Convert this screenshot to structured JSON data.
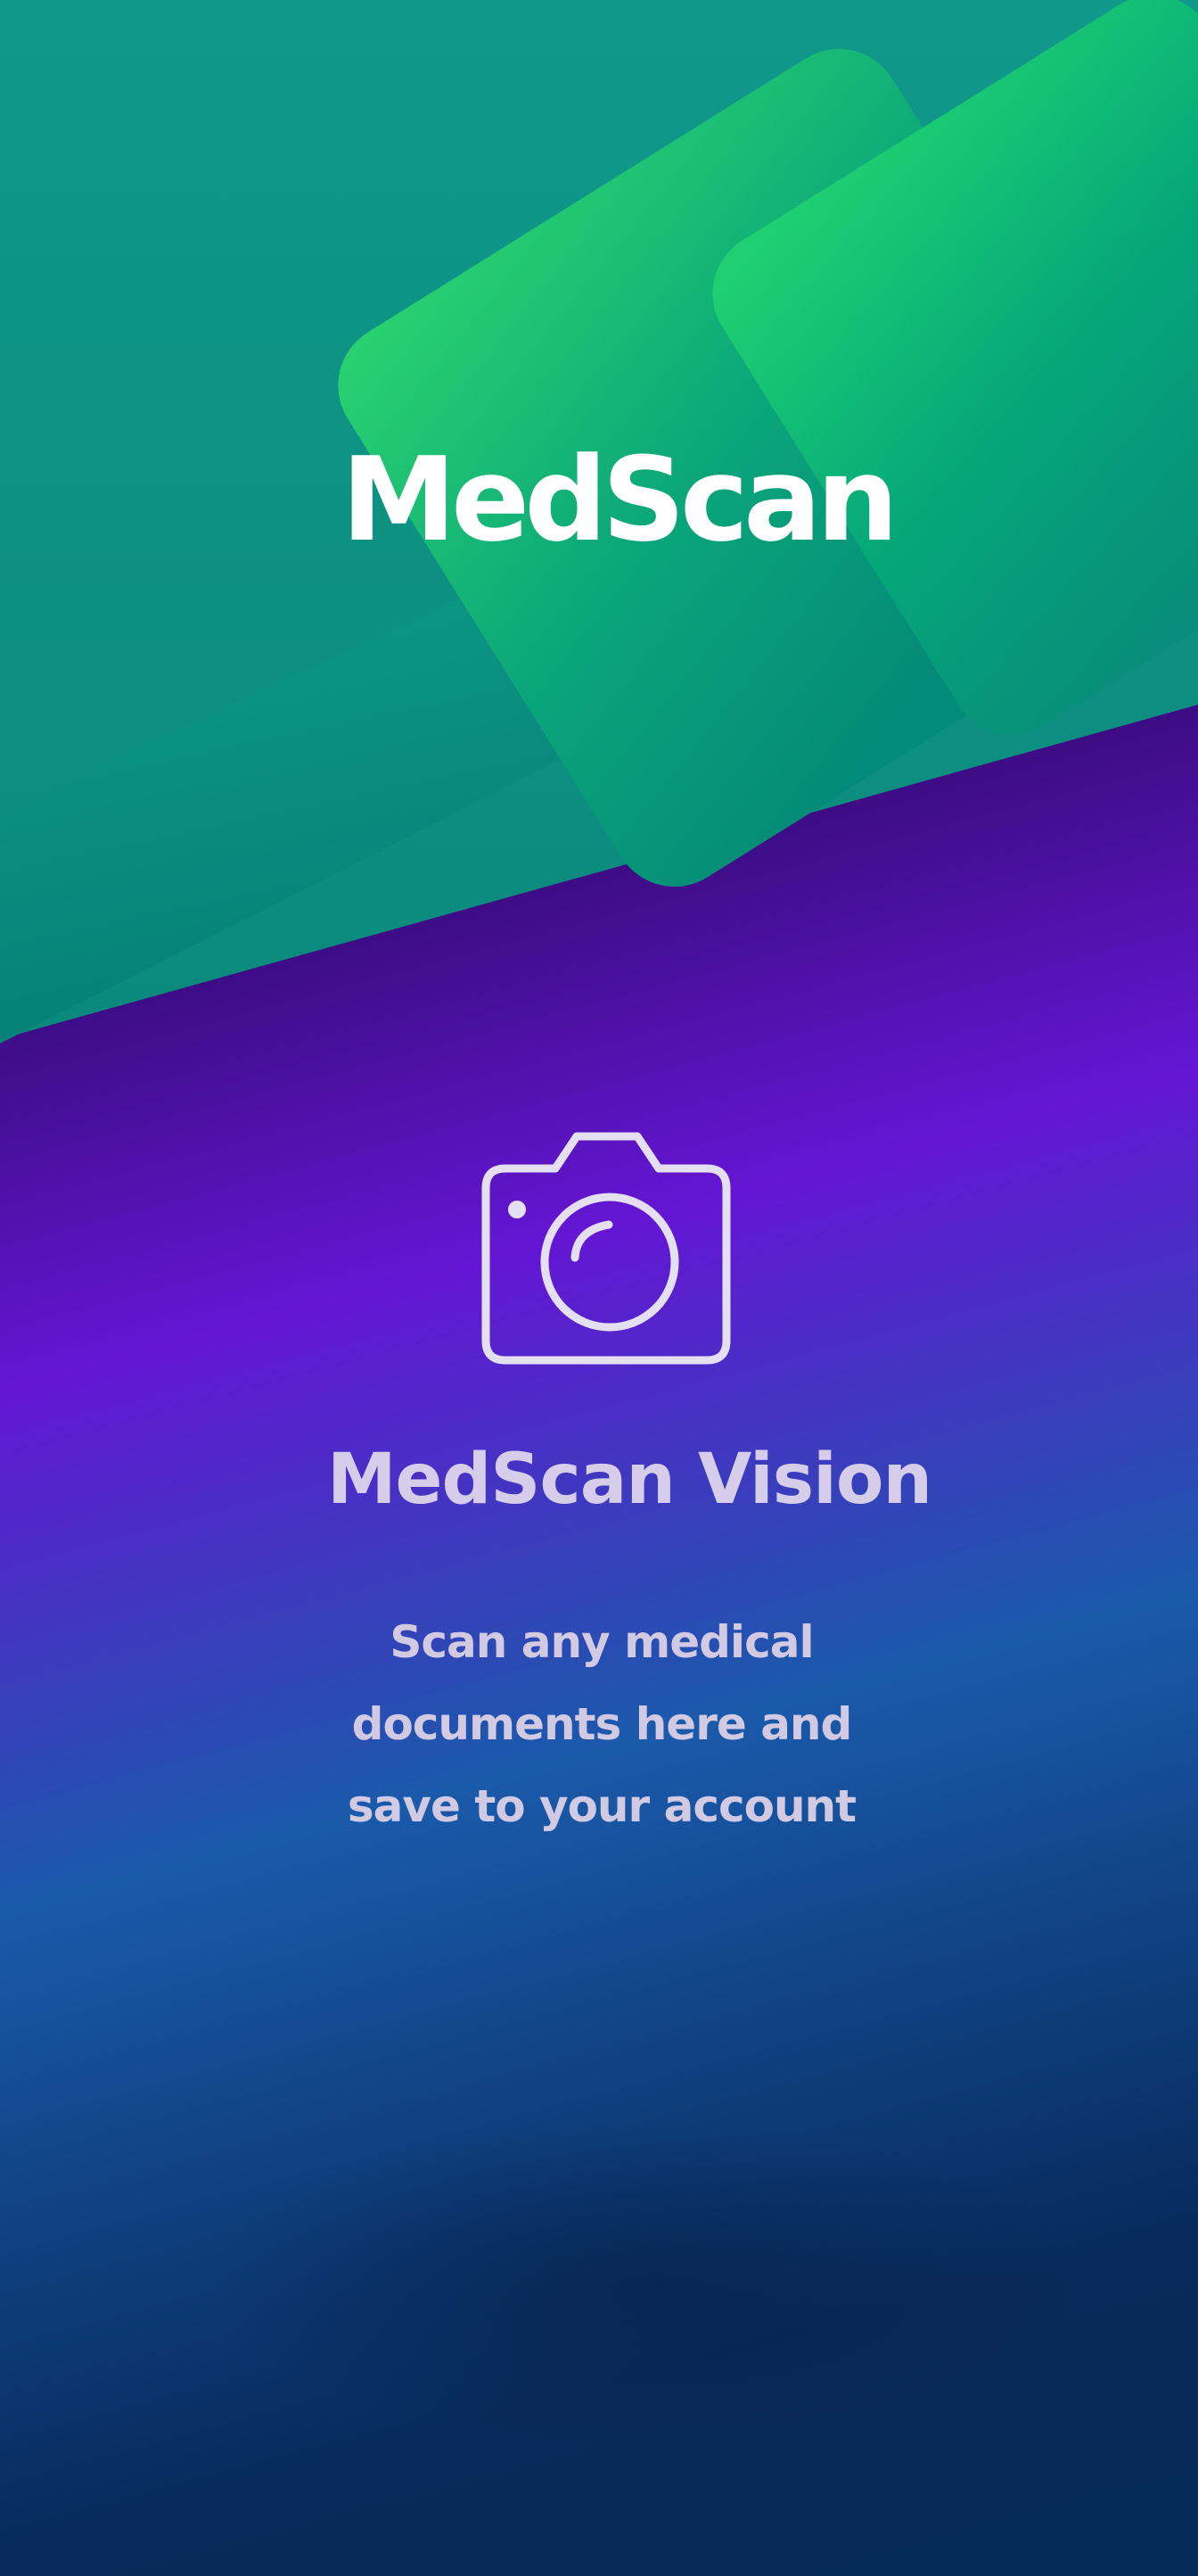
{
  "app": {
    "brand_name": "MedScan"
  },
  "onboarding": {
    "icon": "camera-icon",
    "title": "MedScan Vision",
    "description_lines": [
      "Scan any medical",
      "documents here and",
      "save to your account"
    ]
  },
  "colors": {
    "green_light": "#2ad46f",
    "green_dark": "#008a78",
    "purple": "#6416d4",
    "navy": "#062a58",
    "icon_stroke": "#e5dff2"
  }
}
